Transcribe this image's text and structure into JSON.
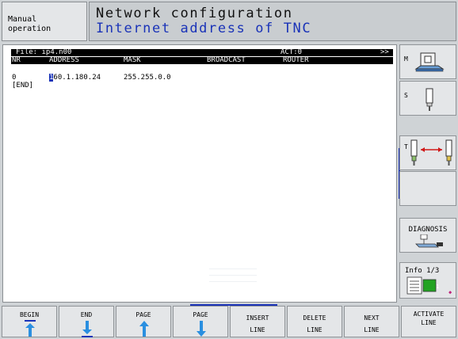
{
  "header": {
    "mode_label": "Manual\noperation",
    "title_line1": "Network configuration",
    "title_line2": "Internet address of TNC"
  },
  "editor": {
    "file_label": "File: ip4.n00",
    "act_label": "ACT:0",
    "scroll_marker": ">>",
    "columns": [
      "NR",
      "ADDRESS",
      "MASK",
      "BROADCAST",
      "ROUTER"
    ],
    "rows": [
      {
        "nr": "0",
        "address_cursor": "1",
        "address_rest": "60.1.180.24",
        "mask": "255.255.0.0",
        "broadcast": "",
        "router": ""
      },
      {
        "nr": "[END]"
      }
    ]
  },
  "right_softkeys": {
    "m_label": "M",
    "s_label": "S",
    "t_label": "T",
    "diagnosis_label": "DIAGNOSIS",
    "info_label": "Info 1/3",
    "info_badge": "1"
  },
  "bottom_softkeys": [
    {
      "line1": "BEGIN",
      "line2": ""
    },
    {
      "line1": "END",
      "line2": ""
    },
    {
      "line1": "PAGE",
      "line2": ""
    },
    {
      "line1": "PAGE",
      "line2": ""
    },
    {
      "line1": "INSERT",
      "line2": "LINE"
    },
    {
      "line1": "DELETE",
      "line2": "LINE"
    },
    {
      "line1": "NEXT",
      "line2": "LINE"
    },
    {
      "line1": "ACTIVATE",
      "line2": "LINE"
    }
  ],
  "colors": {
    "accent_blue": "#1a33b8",
    "key_bg": "#e4e6e8",
    "screen_bg": "#cfd3d6",
    "green": "#22a322",
    "red": "#d01818"
  }
}
